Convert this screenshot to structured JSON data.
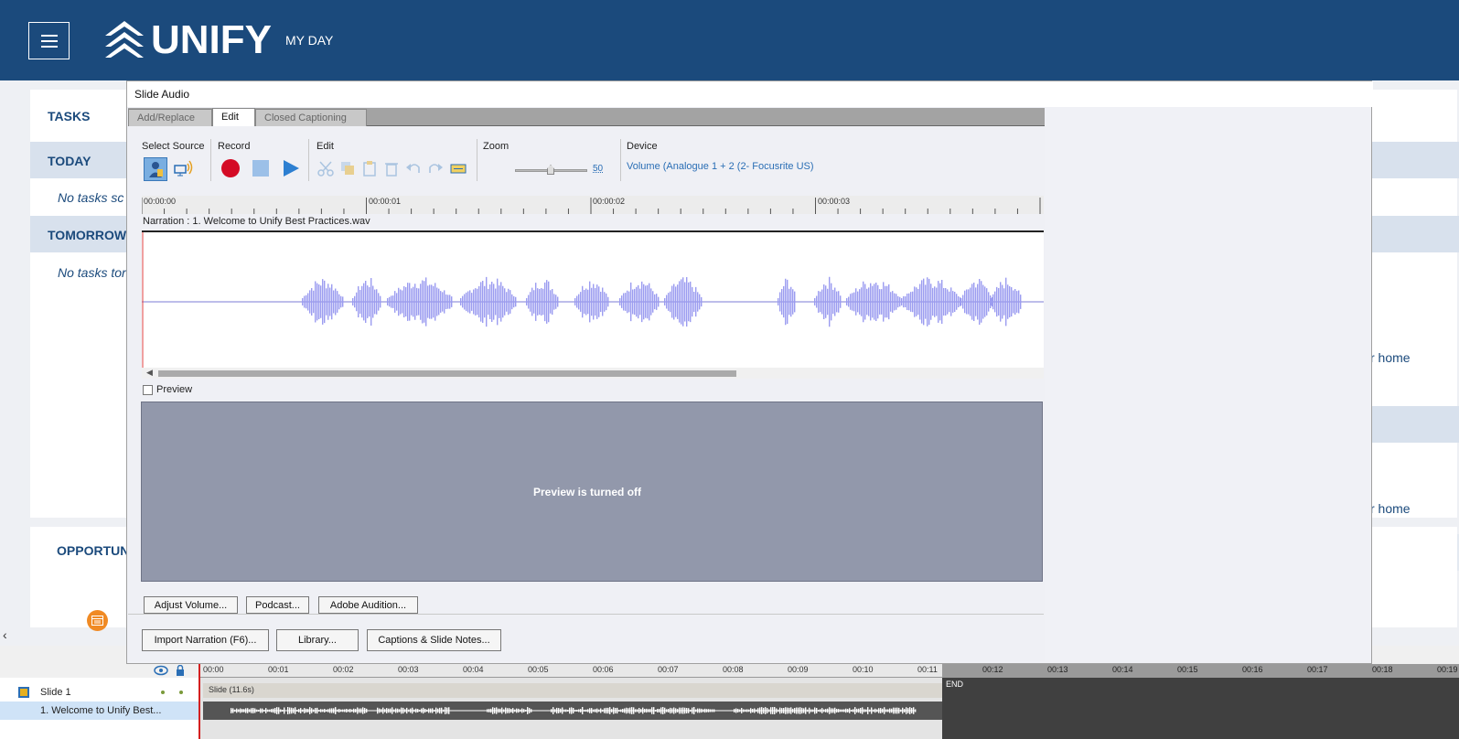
{
  "app": {
    "brand": "UNIFY",
    "nav_label": "MY DAY"
  },
  "tasks": {
    "title": "TASKS",
    "today_label": "TODAY",
    "today_empty": "No tasks sc",
    "tomorrow_label": "TOMORROW",
    "tomorrow_empty": "No tasks tor",
    "right_link_1": "r home",
    "right_link_2": "r home"
  },
  "opportunities": {
    "title": "OPPORTUNI"
  },
  "dialog": {
    "title": "Slide Audio",
    "tabs": [
      "Add/Replace",
      "Edit",
      "Closed Captioning"
    ],
    "active_tab": "Edit",
    "groups": {
      "source": "Select Source",
      "record": "Record",
      "edit": "Edit",
      "zoom": "Zoom",
      "device": "Device"
    },
    "zoom_value": "50",
    "device_value": "Volume (Analogue 1 + 2 (2- Focusrite US)",
    "ruler_ticks": [
      "00:00:00",
      "00:00:01",
      "00:00:02",
      "00:00:03"
    ],
    "narration_label": "Narration : 1. Welcome to Unify Best Practices.wav",
    "preview_label": "Preview",
    "preview_message": "Preview is turned off",
    "buttons": {
      "adjust_volume": "Adjust Volume...",
      "podcast": "Podcast...",
      "adobe_audition": "Adobe Audition...",
      "import_narration": "Import Narration (F6)...",
      "library": "Library...",
      "captions": "Captions & Slide Notes..."
    }
  },
  "timeline": {
    "ticks": [
      "00:00",
      "00:01",
      "00:02",
      "00:03",
      "00:04",
      "00:05",
      "00:06",
      "00:07",
      "00:08",
      "00:09",
      "00:10",
      "00:11",
      "00:12",
      "00:13",
      "00:14",
      "00:15",
      "00:16",
      "00:17",
      "00:18",
      "00:19"
    ],
    "slide_row": "Slide 1",
    "audio_row": "1. Welcome to Unify Best...",
    "slide_bar": "Slide (11.6s)",
    "end_label": "END"
  },
  "colors": {
    "brand_blue": "#1b4a7c",
    "waveform": "#9b9cf0",
    "record_red": "#d40b25",
    "play_blue": "#2d7fd1"
  }
}
